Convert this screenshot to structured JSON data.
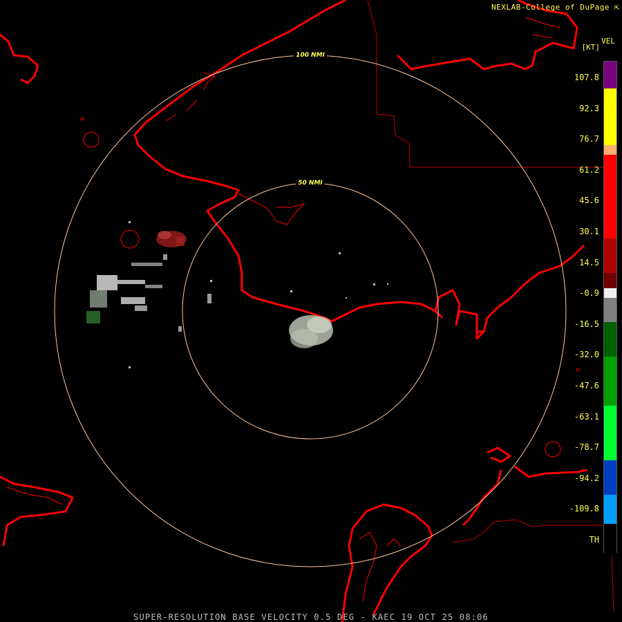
{
  "header": {
    "credit": "NEXLAB-College of DuPage",
    "credit_icon": "link-arrow-icon",
    "product": "VEL",
    "units": "[KT]"
  },
  "rings": [
    {
      "label": "100 NMI"
    },
    {
      "label": "50 NMI"
    }
  ],
  "legend": {
    "ticks": [
      "107.8",
      "92.3",
      "76.7",
      "61.2",
      "45.6",
      "30.1",
      "14.5",
      "-0.9",
      "-16.5",
      "-32.0",
      "-47.6",
      "-63.1",
      "-78.7",
      "-94.2",
      "-109.8",
      "TH"
    ],
    "segments": [
      {
        "color": "#7a0080",
        "from": 0.0,
        "to": 0.055
      },
      {
        "color": "#ffff00",
        "from": 0.055,
        "to": 0.17
      },
      {
        "color": "#ffb070",
        "from": 0.17,
        "to": 0.19
      },
      {
        "color": "#ff0000",
        "from": 0.19,
        "to": 0.36
      },
      {
        "color": "#b00000",
        "from": 0.36,
        "to": 0.43
      },
      {
        "color": "#700000",
        "from": 0.43,
        "to": 0.46
      },
      {
        "color": "#f0f0f0",
        "from": 0.46,
        "to": 0.48
      },
      {
        "color": "#808080",
        "from": 0.48,
        "to": 0.53
      },
      {
        "color": "#006000",
        "from": 0.53,
        "to": 0.6
      },
      {
        "color": "#00a000",
        "from": 0.6,
        "to": 0.7
      },
      {
        "color": "#00ff30",
        "from": 0.7,
        "to": 0.81
      },
      {
        "color": "#0040c0",
        "from": 0.81,
        "to": 0.88
      },
      {
        "color": "#00a0ff",
        "from": 0.88,
        "to": 0.94
      },
      {
        "color": "#000000",
        "from": 0.94,
        "to": 1.0
      }
    ]
  },
  "footer": {
    "caption": "SUPER-RESOLUTION BASE VELOCITY 0.5 DEG - KAEC 19 OCT 25 08:06"
  },
  "colors": {
    "coastline": "#ff0000",
    "borders": "#c00000",
    "range_rings": "#ffc8a0",
    "text": "#ffff55",
    "footer_text": "#bdbdbd"
  }
}
